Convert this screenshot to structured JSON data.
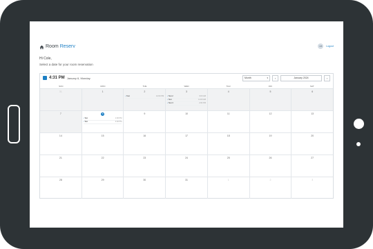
{
  "brand": {
    "prefix": "Room",
    "highlight": "Reserv"
  },
  "user": {
    "avatar_initials": "CB",
    "logout_label": "Logout"
  },
  "greeting": "Hi Cole,",
  "subtitle": "Select a date for your room reservation",
  "toolbar": {
    "time": "4:31 PM",
    "date": "January 6, Monday",
    "view_select": "Month",
    "prev": "‹",
    "next": "›",
    "month_label": "January 2024"
  },
  "weekdays": [
    "SUN",
    "MON",
    "TUE",
    "WED",
    "THU",
    "FRI",
    "SAT"
  ],
  "weeks": [
    [
      {
        "day": "31",
        "past": true,
        "other": true
      },
      {
        "day": "1",
        "past": true
      },
      {
        "day": "2",
        "past": true,
        "events": [
          {
            "title": "Test",
            "time": "12:00 PM"
          }
        ]
      },
      {
        "day": "3",
        "past": true,
        "events": [
          {
            "title": "Test 2",
            "time": "9:00 AM"
          },
          {
            "title": "Test",
            "time": "11:00 AM"
          },
          {
            "title": "Test 3",
            "time": "2:00 PM"
          }
        ]
      },
      {
        "day": "4",
        "past": true
      },
      {
        "day": "5",
        "past": true
      },
      {
        "day": "6",
        "past": true
      }
    ],
    [
      {
        "day": "7",
        "past": true
      },
      {
        "day": "8",
        "today": true,
        "events": [
          {
            "title": "Test",
            "time": "1:00 PM"
          },
          {
            "title": "Test",
            "time": "3:00 PM"
          }
        ]
      },
      {
        "day": "9"
      },
      {
        "day": "10"
      },
      {
        "day": "11"
      },
      {
        "day": "12"
      },
      {
        "day": "13"
      }
    ],
    [
      {
        "day": "14"
      },
      {
        "day": "15"
      },
      {
        "day": "16"
      },
      {
        "day": "17"
      },
      {
        "day": "18"
      },
      {
        "day": "19"
      },
      {
        "day": "20"
      }
    ],
    [
      {
        "day": "21"
      },
      {
        "day": "22"
      },
      {
        "day": "23"
      },
      {
        "day": "24"
      },
      {
        "day": "25"
      },
      {
        "day": "26"
      },
      {
        "day": "27"
      }
    ],
    [
      {
        "day": "28"
      },
      {
        "day": "29"
      },
      {
        "day": "30"
      },
      {
        "day": "31"
      },
      {
        "day": "1",
        "other": true
      },
      {
        "day": "2",
        "other": true
      },
      {
        "day": "3",
        "other": true
      }
    ]
  ],
  "colors": {
    "accent": "#1c7fc4",
    "bezel": "#2d3336",
    "past_cell": "#f1f2f3"
  }
}
